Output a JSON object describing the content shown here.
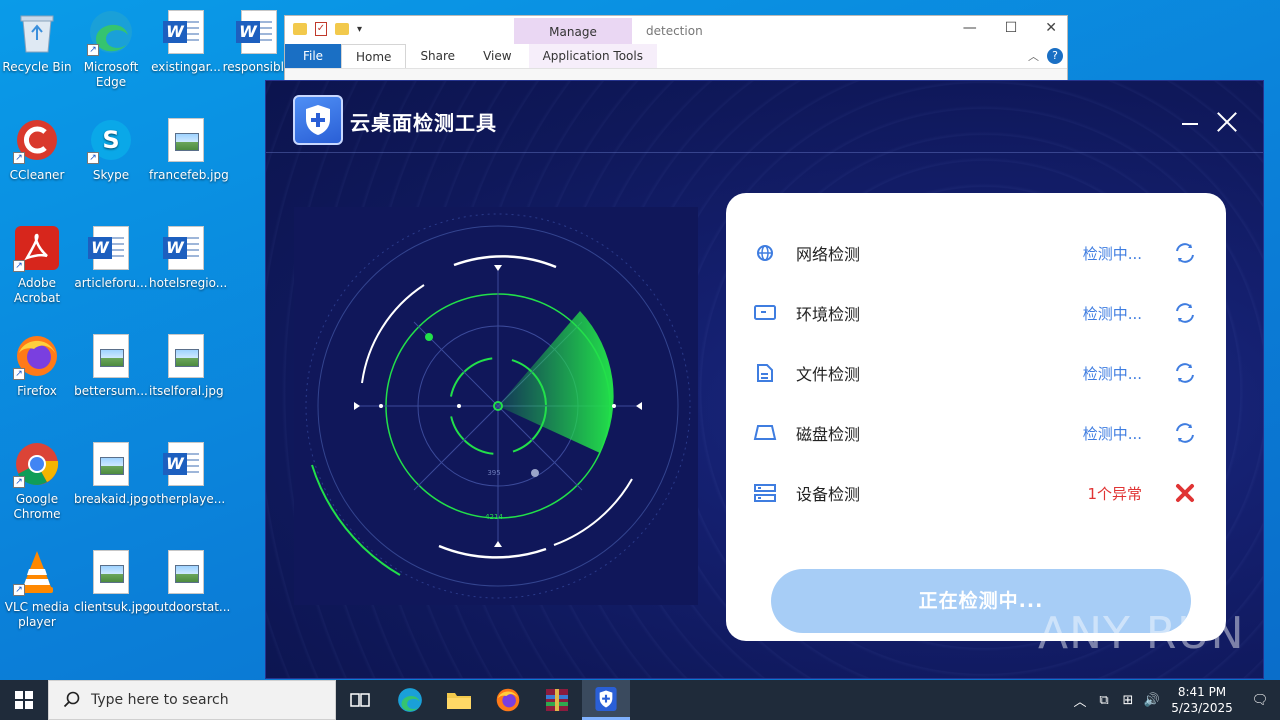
{
  "desktop": {
    "icons": [
      {
        "label": "Recycle Bin"
      },
      {
        "label": "Microsoft Edge"
      },
      {
        "label": "existingar..."
      },
      {
        "label": "responsibl..."
      },
      {
        "label": "CCleaner"
      },
      {
        "label": "Skype"
      },
      {
        "label": "francefeb.jpg"
      },
      {
        "label": "Adobe Acrobat"
      },
      {
        "label": "articleforu..."
      },
      {
        "label": "hotelsregio..."
      },
      {
        "label": "Firefox"
      },
      {
        "label": "bettersum..."
      },
      {
        "label": "itselforal.jpg"
      },
      {
        "label": "Google Chrome"
      },
      {
        "label": "breakaid.jpg"
      },
      {
        "label": "otherplaye..."
      },
      {
        "label": "VLC media player"
      },
      {
        "label": "clientsuk.jpg"
      },
      {
        "label": "outdoorstat..."
      }
    ]
  },
  "explorer": {
    "manage_tab": "Manage",
    "window_title": "detection",
    "tabs": [
      "File",
      "Home",
      "Share",
      "View",
      "Application Tools"
    ]
  },
  "app": {
    "title": "云桌面检测工具",
    "radar": {
      "label_a": "395",
      "label_b": "4214"
    },
    "checks": [
      {
        "label": "网络检测",
        "status": "检测中...",
        "icon": "globe-icon",
        "state": "spinner"
      },
      {
        "label": "环境检测",
        "status": "检测中...",
        "icon": "monitor-icon",
        "state": "spinner"
      },
      {
        "label": "文件检测",
        "status": "检测中...",
        "icon": "file-icon",
        "state": "spinner"
      },
      {
        "label": "磁盘检测",
        "status": "检测中...",
        "icon": "disk-icon",
        "state": "spinner"
      },
      {
        "label": "设备检测",
        "status": "1个异常",
        "icon": "server-icon",
        "state": "error"
      }
    ],
    "button_label": "正在检测中..."
  },
  "colors": {
    "accent": "#3f7de0",
    "error": "#e03434",
    "radar_green": "#22e04a",
    "app_bg": "#141f6e"
  },
  "watermark": "ANY RUN",
  "taskbar": {
    "search_placeholder": "Type here to search",
    "time": "8:41 PM",
    "date": "5/23/2025"
  }
}
